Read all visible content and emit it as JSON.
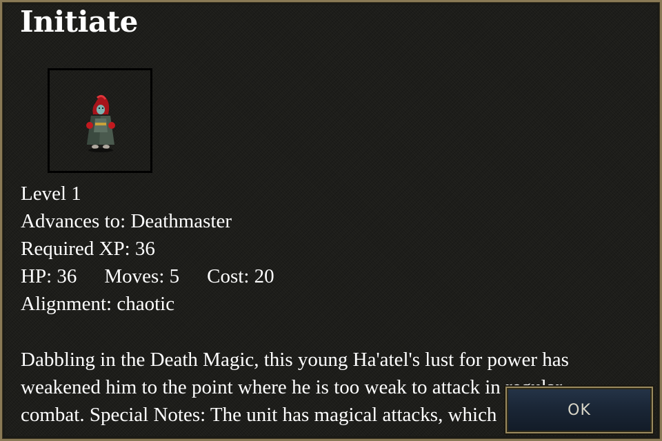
{
  "unit": {
    "name": "Initiate",
    "portrait_icon": "red-hooded-mage-sprite"
  },
  "stats": {
    "level": "Level 1",
    "advances_to": "Advances to: Deathmaster",
    "required_xp": "Required XP: 36",
    "hp": "HP: 36",
    "moves": "Moves: 5",
    "cost": "Cost: 20",
    "alignment": "Alignment: chaotic"
  },
  "description": {
    "lines": [
      "Dabbling in the Death Magic, this young Ha'atel's lust for power has",
      "weakened him to the point where he is too weak to attack in regular",
      "combat. Special Notes: The unit has magical attacks, which"
    ]
  },
  "buttons": {
    "ok_label": "OK"
  },
  "colors": {
    "frame_border": "#8a7a56",
    "panel_background": "#1d1d1a",
    "text": "#ffffff",
    "button_fill": "#1a2636",
    "button_text": "#d9d6c8"
  }
}
